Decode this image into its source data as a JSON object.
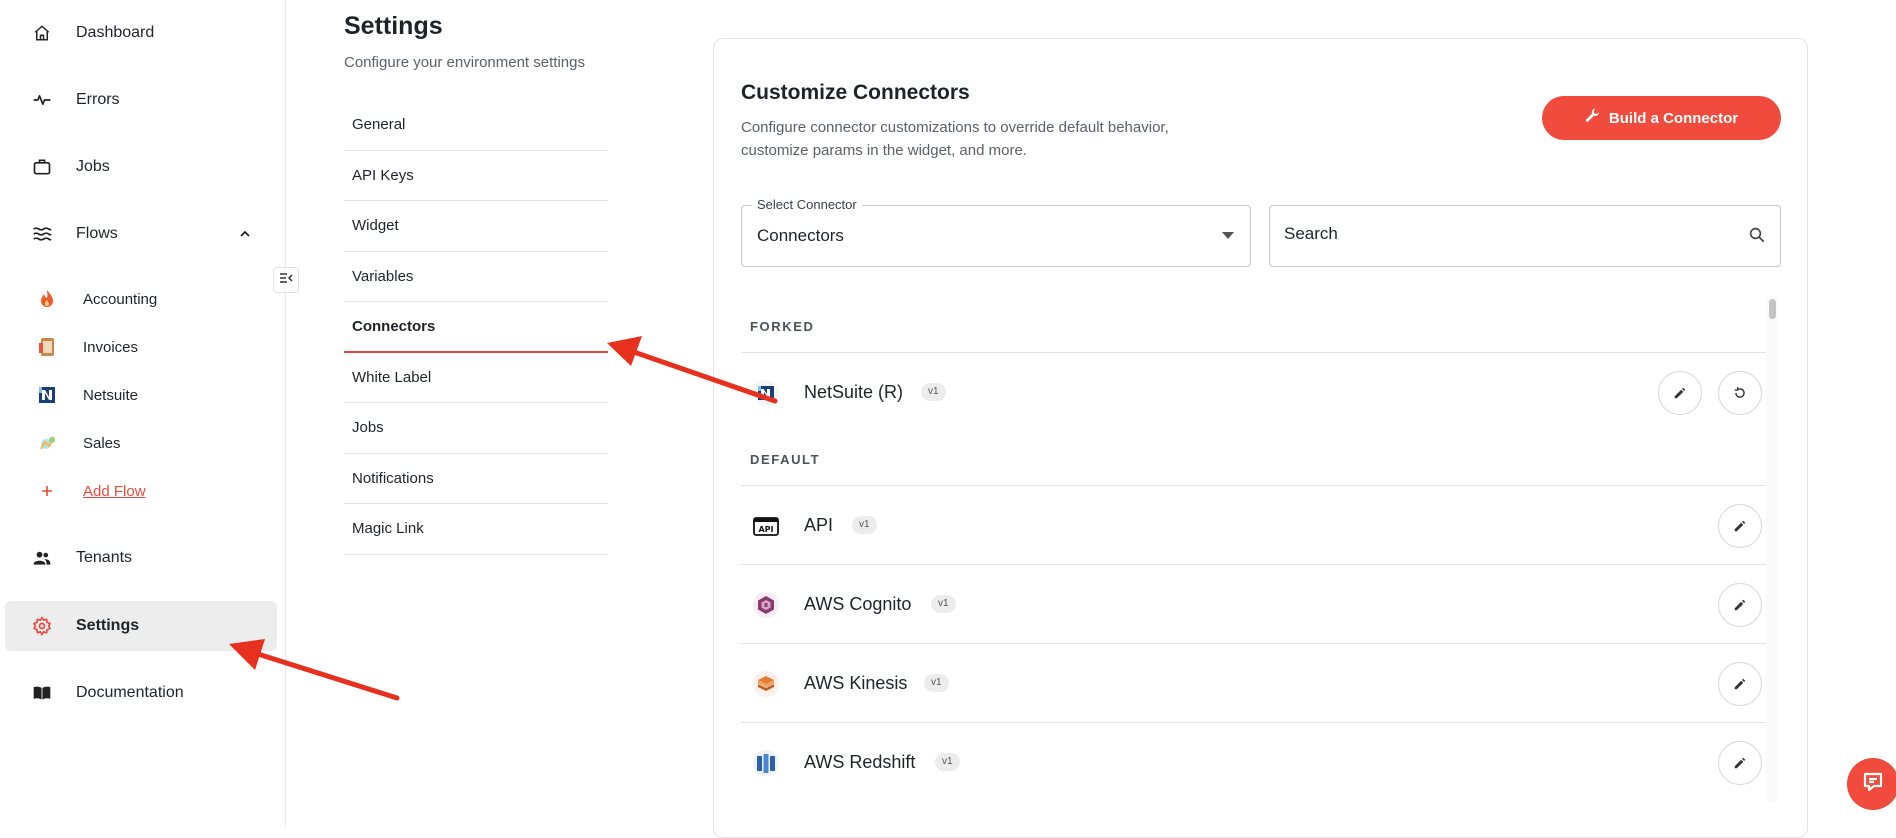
{
  "sidebar": {
    "items": [
      {
        "label": "Dashboard",
        "icon": "home-icon"
      },
      {
        "label": "Errors",
        "icon": "activity-icon"
      },
      {
        "label": "Jobs",
        "icon": "briefcase-icon"
      },
      {
        "label": "Flows",
        "icon": "waves-icon"
      },
      {
        "label": "Tenants",
        "icon": "people-icon"
      },
      {
        "label": "Settings",
        "icon": "gear-icon"
      },
      {
        "label": "Documentation",
        "icon": "book-icon"
      }
    ],
    "flows": [
      {
        "label": "Accounting",
        "icon": "flame-icon"
      },
      {
        "label": "Invoices",
        "icon": "invoice-icon"
      },
      {
        "label": "Netsuite",
        "icon": "netsuite-icon"
      },
      {
        "label": "Sales",
        "icon": "sales-icon"
      }
    ],
    "add_flow_label": "Add Flow",
    "active": "Settings",
    "accent_color": "#e84a3c"
  },
  "header": {
    "title": "Settings",
    "subtitle": "Configure your environment settings"
  },
  "settings_menu": {
    "items": [
      "General",
      "API Keys",
      "Widget",
      "Variables",
      "Connectors",
      "White Label",
      "Jobs",
      "Notifications",
      "Magic Link"
    ],
    "active": "Connectors"
  },
  "panel": {
    "title": "Customize Connectors",
    "description": "Configure connector customizations to override default behavior, customize params in the widget, and more.",
    "build_button": "Build a Connector",
    "select": {
      "legend": "Select Connector",
      "value": "Connectors"
    },
    "search": {
      "placeholder": "Search"
    },
    "groups": {
      "forked": {
        "label": "FORKED",
        "items": [
          {
            "name": "NetSuite (R)",
            "version": "v1",
            "icon": "netsuite-icon"
          }
        ]
      },
      "default": {
        "label": "DEFAULT",
        "items": [
          {
            "name": "API",
            "version": "v1",
            "icon": "api-icon"
          },
          {
            "name": "AWS Cognito",
            "version": "v1",
            "icon": "aws-cognito-icon"
          },
          {
            "name": "AWS Kinesis",
            "version": "v1",
            "icon": "aws-kinesis-icon"
          },
          {
            "name": "AWS Redshift",
            "version": "v1",
            "icon": "aws-redshift-icon"
          }
        ]
      }
    }
  },
  "colors": {
    "accent": "#f04b3c",
    "annotation_arrow": "#e8301e"
  }
}
